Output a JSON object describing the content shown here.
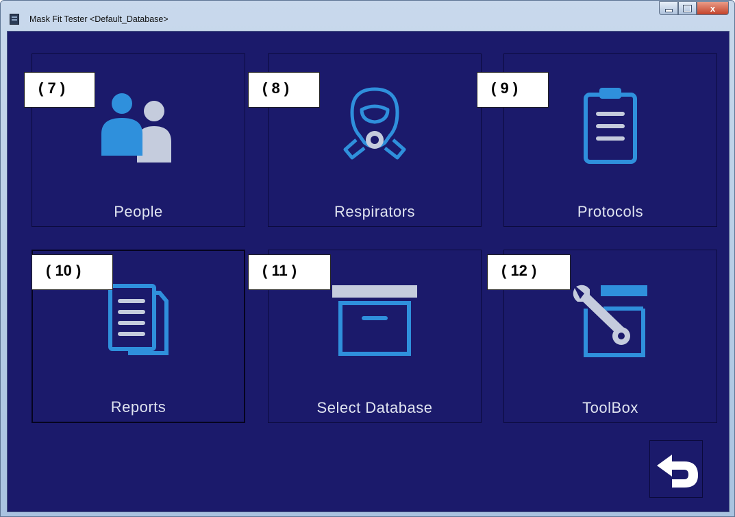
{
  "window": {
    "title": "Mask Fit Tester <Default_Database>",
    "controls": [
      "minimize",
      "maximize",
      "close"
    ],
    "close_glyph": "x"
  },
  "tiles": [
    {
      "label": "People",
      "icon": "people-icon",
      "callout": "( 7 )"
    },
    {
      "label": "Respirators",
      "icon": "respirator-mask-icon",
      "callout": "( 8 )"
    },
    {
      "label": "Protocols",
      "icon": "clipboard-icon",
      "callout": "( 9 )"
    },
    {
      "label": "Reports",
      "icon": "documents-icon",
      "callout": "( 10 )"
    },
    {
      "label": "Select Database",
      "icon": "archive-box-icon",
      "callout": "( 11 )"
    },
    {
      "label": "ToolBox",
      "icon": "toolbox-wrench-icon",
      "callout": "( 12 )"
    }
  ],
  "back_button": {
    "icon": "back-arrow-icon"
  },
  "colors": {
    "background": "#1b1a6b",
    "icon_blue": "#2f90dc",
    "icon_gray": "#c5ccdd",
    "label_text": "#dfe3ef",
    "callout_bg": "#ffffff"
  }
}
